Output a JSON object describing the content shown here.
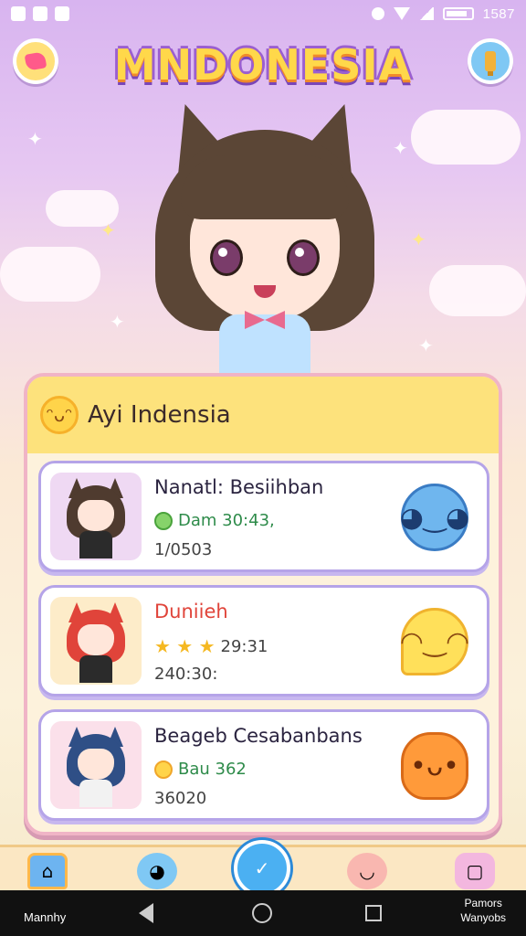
{
  "status_bar": {
    "time": "1587"
  },
  "header": {
    "title": "MNDONESIA",
    "left_button_icon": "heart-chat-icon",
    "right_button_icon": "trophy-icon"
  },
  "panel": {
    "title": "Ayi Indensia",
    "title_icon": "smiley-icon",
    "rows": [
      {
        "name": "Nanatl: Besiihban",
        "stat": "Dam 30:43,",
        "stat_icon": "green-badge-icon",
        "sub": "1/0503",
        "mascot_icon": "blue-blob-mascot-icon"
      },
      {
        "name": "Duniieh",
        "stars": "★ ★ ★",
        "stat": "29:31",
        "sub": "240:30:",
        "mascot_icon": "yellow-speech-mascot-icon"
      },
      {
        "name": "Beageb Cesabanbans",
        "stat": "Bau 362",
        "stat_icon": "yellow-flower-icon",
        "sub": "36020",
        "mascot_icon": "orange-creature-mascot-icon"
      }
    ]
  },
  "tabbar": {
    "items": [
      "home-icon",
      "blue-creature-icon",
      "chat-center-icon",
      "pink-creature-icon",
      "pink-bag-icon"
    ]
  },
  "navbar": {
    "left_label": "Mannhy",
    "right_label_line1": "Pamors",
    "right_label_line2": "Wanyobs"
  },
  "colors": {
    "title_fill": "#ffd84a",
    "title_outline": "#9b5fd0",
    "panel_border": "#f0b4c6",
    "row_border": "#b5a4e8",
    "accent_red": "#e0443a"
  }
}
